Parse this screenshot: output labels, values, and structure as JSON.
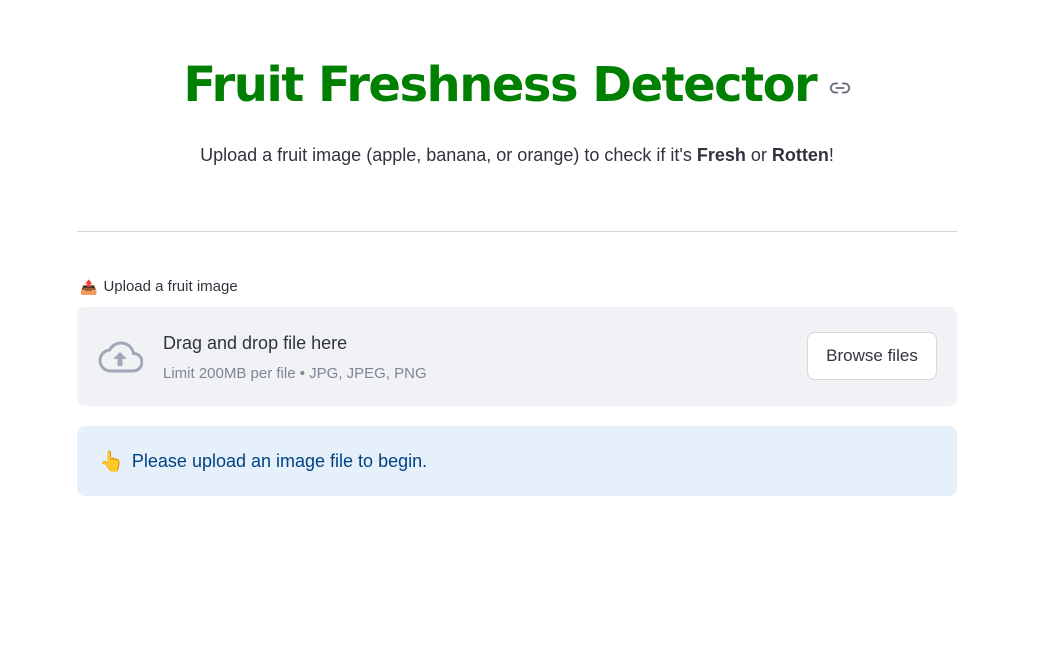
{
  "header": {
    "title": "Fruit Freshness Detector",
    "anchor_icon": "link-icon",
    "title_color": "#008000",
    "subtitle_prefix": "Upload a fruit image (apple, banana, or orange) to check if it's ",
    "subtitle_fresh": "Fresh",
    "subtitle_or": " or ",
    "subtitle_rotten": "Rotten",
    "subtitle_suffix": "!"
  },
  "uploader": {
    "label_emoji": "📤",
    "label": "Upload a fruit image",
    "icon": "cloud-upload-icon",
    "drag_text": "Drag and drop file here",
    "limit_text": "Limit 200MB per file • JPG, JPEG, PNG",
    "browse_label": "Browse files"
  },
  "info": {
    "emoji": "👆",
    "message": "Please upload an image file to begin.",
    "background": "#e6f0fb",
    "text_color": "#004280"
  }
}
